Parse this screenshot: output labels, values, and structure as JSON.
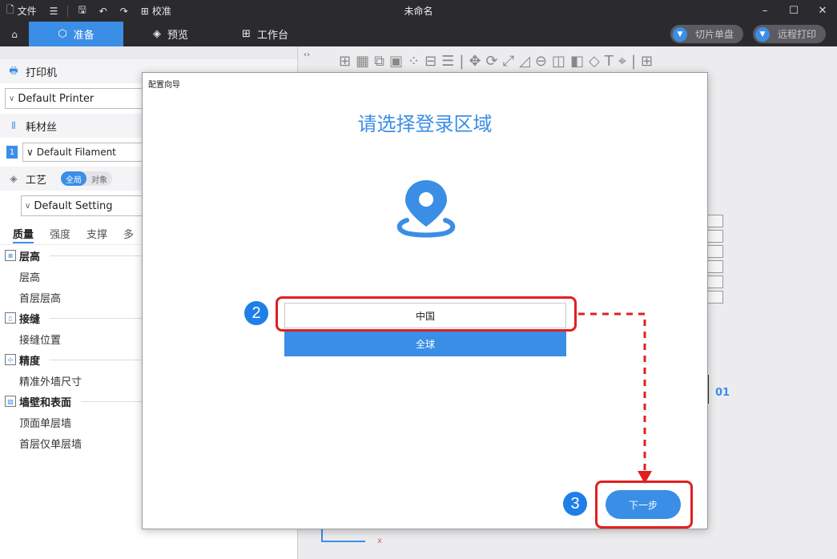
{
  "titlebar": {
    "file_label": "文件",
    "calibrate_label": "校准",
    "window_title": "未命名"
  },
  "tabs": [
    {
      "label": "准备",
      "active": true
    },
    {
      "label": "预览",
      "active": false
    },
    {
      "label": "工作台",
      "active": false
    }
  ],
  "actions": {
    "slice_label": "切片单盘",
    "remote_print_label": "远程打印"
  },
  "left_panel": {
    "printer_section": "打印机",
    "printer_value": "Default Printer",
    "filament_section": "耗材丝",
    "filament_index": "1",
    "filament_value": "Default Filament",
    "process_section": "工艺",
    "toggle_on": "全局",
    "toggle_off": "对象",
    "process_value": "Default Setting",
    "subtabs": [
      "质量",
      "强度",
      "支撑",
      "多"
    ],
    "groups": [
      {
        "title": "层高",
        "params": [
          "层高",
          "首层层高"
        ]
      },
      {
        "title": "接缝",
        "params": [
          "接缝位置"
        ]
      },
      {
        "title": "精度",
        "params": [
          "精准外墙尺寸"
        ]
      },
      {
        "title": "墙壁和表面",
        "params": [
          "顶面单层墙",
          "首层仅单层墙"
        ]
      }
    ]
  },
  "canvas": {
    "plate_label": "01",
    "axis_x_label": "x"
  },
  "dialog": {
    "title": "配置向导",
    "heading": "请选择登录区域",
    "option_china": "中国",
    "option_global": "全球",
    "next_label": "下一步"
  },
  "annotations": {
    "step2": "2",
    "step3": "3"
  },
  "colors": {
    "accent": "#3a8ee6",
    "highlight": "#e02020",
    "titlebar_bg": "#2b2b2f"
  }
}
